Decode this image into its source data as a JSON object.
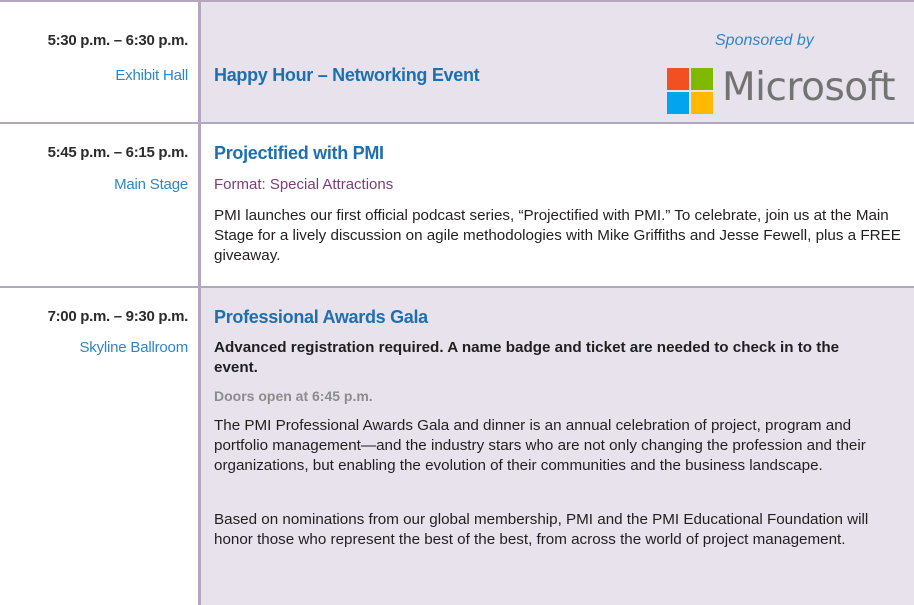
{
  "rows": [
    {
      "time": "5:30 p.m. – 6:30 p.m.",
      "venue": "Exhibit Hall",
      "title": "Happy Hour – Networking Event",
      "sponsor": {
        "label": "Sponsored by",
        "wordmark": "Microsoft",
        "logo_colors": [
          "#f25022",
          "#7fba00",
          "#00a4ef",
          "#ffb900"
        ]
      }
    },
    {
      "time": "5:45 p.m. – 6:15 p.m.",
      "venue": "Main Stage",
      "title": "Projectified with PMI",
      "format": "Format: Special Attractions",
      "description": "PMI launches our first official podcast series, “Projectified with PMI.” To celebrate, join us at the Main Stage for a lively discussion on agile methodologies with Mike Griffiths and Jesse Fewell, plus a FREE giveaway."
    },
    {
      "time": "7:00 p.m. – 9:30 p.m.",
      "venue": "Skyline Ballroom",
      "title": "Professional Awards Gala",
      "notice": "Advanced registration required. A name badge and ticket are needed to check in to the event.",
      "doors": "Doors open at 6:45 p.m.",
      "paragraphs": [
        "The PMI Professional Awards Gala and dinner is an annual celebration of project, program and portfolio management—and the industry stars who are not only changing the profession and their organizations, but enabling the evolution of their communities and the business landscape.",
        "Based on nominations from our global membership, PMI and the PMI Educational Foundation will honor those who represent the best of the best, from across the world of project management."
      ]
    }
  ],
  "colors": {
    "rule": "#b3a7bf",
    "shade": "#e7e2ec",
    "title_blue": "#1e6fb0",
    "venue_blue": "#2f86c6",
    "format_purple": "#7a3e76"
  }
}
